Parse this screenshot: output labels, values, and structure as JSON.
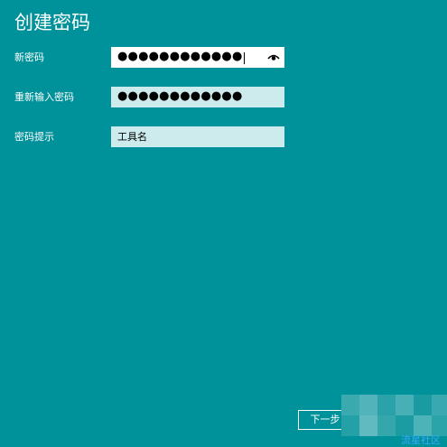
{
  "page": {
    "title": "创建密码"
  },
  "form": {
    "new_password": {
      "label": "新密码",
      "value": "●●●●●●●●●●●●"
    },
    "confirm_password": {
      "label": "重新输入密码",
      "value": "●●●●●●●●●●●●"
    },
    "password_hint": {
      "label": "密码提示",
      "value": "工具名"
    }
  },
  "buttons": {
    "next_label": "下一步"
  },
  "icons": {
    "reveal": "eye-icon"
  },
  "watermark": {
    "text": "流星社区"
  },
  "colors": {
    "background": "#00929a",
    "input_active": "#ffffff",
    "input_inactive": "#cdeaec",
    "watermark": "#3aa8ff"
  }
}
